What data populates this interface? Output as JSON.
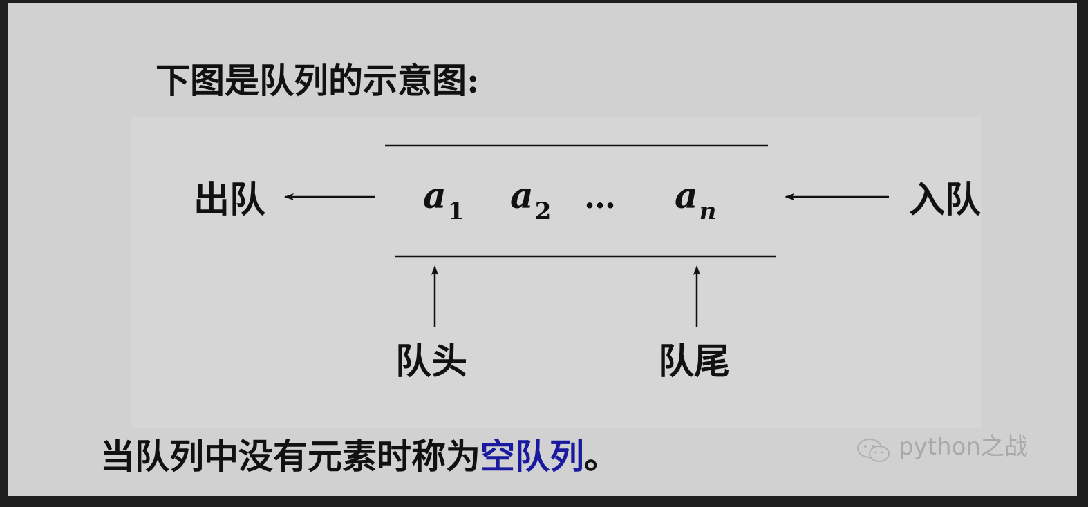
{
  "diagram": {
    "heading": "下图是队列的示意图:",
    "dequeue_label": "出队",
    "enqueue_label": "入队",
    "elements": [
      {
        "base": "a",
        "sub": "1"
      },
      {
        "base": "a",
        "sub": "2"
      },
      {
        "base": "…",
        "sub": ""
      },
      {
        "base": "a",
        "sub": "n"
      }
    ],
    "queue_head_label": "队头",
    "queue_tail_label": "队尾",
    "footer_text": "当队列中没有元素时称为",
    "footer_highlight": "空队列",
    "footer_end": "。",
    "highlight_color": "#1a1aa0"
  },
  "watermark": {
    "text": "python之战",
    "icon": "wechat-logo-icon"
  }
}
